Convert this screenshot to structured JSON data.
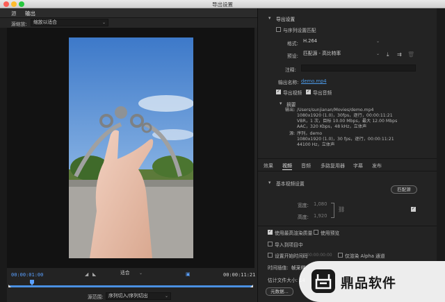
{
  "window": {
    "title": "导出设置"
  },
  "left": {
    "tabs": [
      "源",
      "输出"
    ],
    "source_scaling_label": "源缩放:",
    "source_scaling_value": "缩放以适合",
    "timecode_start": "00:00:01:00",
    "zoom_value": "适合",
    "timecode_end": "00:00:11:21",
    "range_label": "源范围:",
    "range_value": "序列切入/序列切出"
  },
  "right": {
    "export_settings_header": "导出设置",
    "match_sequence_label": "与序列设置匹配",
    "format_label": "格式:",
    "format_value": "H.264",
    "preset_label": "预设:",
    "preset_value": "匹配源 - 高比特率",
    "comments_label": "注释:",
    "output_name_label": "输出名称:",
    "output_name_value": "demo.mp4",
    "export_video_label": "导出视频",
    "export_audio_label": "导出音频",
    "summary_header": "摘要",
    "summary_output_label": "输出:",
    "summary_output_lines": [
      "/Users/sunjianan/Movies/demo.mp4",
      "1080x1920 (1.0)，30fps，逐行，00:00:11:21",
      "VBR，1 次，目标 10.00 Mbps，最大 12.00 Mbps",
      "AAC，320 Kbps，48  kHz，立体声"
    ],
    "summary_source_label": "源:",
    "summary_source_lines": [
      "序列，demo",
      "1080x1920 (1.0)，30 fps，逐行，00:00:11:21",
      "44100 Hz，立体声"
    ],
    "tabs": [
      "效果",
      "视频",
      "音频",
      "多路复用器",
      "字幕",
      "发布"
    ],
    "basic_video_header": "基本视频设置",
    "match_source_button": "匹配源",
    "width_label": "宽度:",
    "width_value": "1,080",
    "height_label": "高度:",
    "height_value": "1,920",
    "max_render_quality_label": "使用最高渲染质量",
    "use_previews_label": "使用预览",
    "import_project_label": "导入到项目中",
    "set_start_timecode_label": "设置开始时间码",
    "start_timecode_value": "00:00:00:00",
    "render_alpha_label": "仅渲染 Alpha 通道",
    "time_interpolation_label": "时间插值:",
    "time_interpolation_value": "帧采样",
    "est_file_size_label": "估计文件大小: 14",
    "metadata_button": "元数据..."
  },
  "watermark": {
    "text": "鼎品软件"
  },
  "colors": {
    "accent_blue": "#4a90e2",
    "timecode_blue": "#5aa0ff",
    "link_blue": "#4c9bea"
  }
}
